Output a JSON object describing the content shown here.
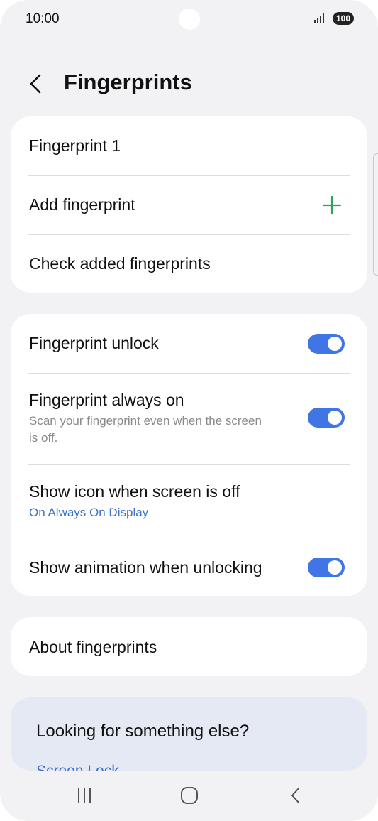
{
  "status_bar": {
    "time": "10:00",
    "battery": "100"
  },
  "header": {
    "title": "Fingerprints"
  },
  "fingerprints_card": {
    "items": [
      {
        "label": "Fingerprint 1"
      },
      {
        "label": "Add fingerprint",
        "icon": "plus-icon"
      },
      {
        "label": "Check added fingerprints"
      }
    ]
  },
  "settings_card": {
    "items": [
      {
        "label": "Fingerprint unlock",
        "toggle": true
      },
      {
        "label": "Fingerprint always on",
        "sub": "Scan your fingerprint even when the screen is off.",
        "toggle": true
      },
      {
        "label": "Show icon when screen is off",
        "sub": "On Always On Display"
      },
      {
        "label": "Show animation when unlocking",
        "toggle": true
      }
    ]
  },
  "about_card": {
    "label": "About fingerprints"
  },
  "suggestions": {
    "title": "Looking for something else?",
    "link": "Screen Lock"
  },
  "colors": {
    "accent": "#3f75e4",
    "plus": "#2fa35a",
    "link": "#3b73c9",
    "background": "#f2f2f4"
  }
}
